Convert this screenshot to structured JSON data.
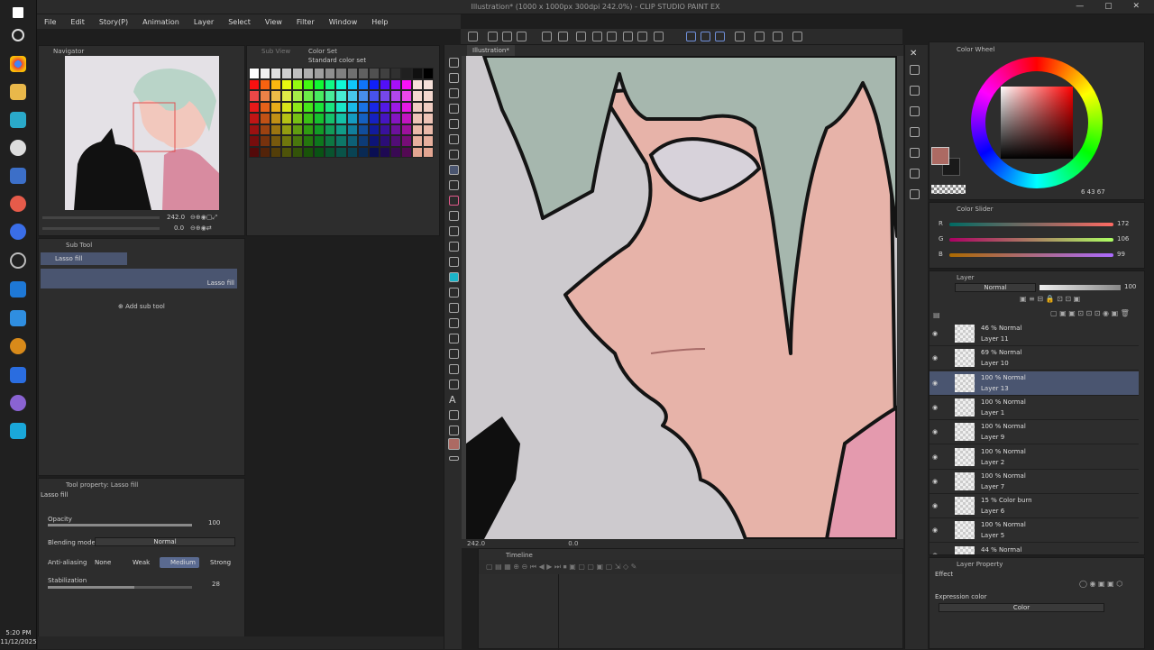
{
  "app": {
    "title": "Illustration* (1000 x 1000px 300dpi 242.0%) - CLIP STUDIO PAINT EX",
    "window_controls": "— ▢ ✕"
  },
  "menu": [
    "File",
    "Edit",
    "Story(P)",
    "Animation",
    "Layer",
    "Select",
    "View",
    "Filter",
    "Window",
    "Help"
  ],
  "taskbar": {
    "time": "5:20 PM",
    "date": "11/12/2025"
  },
  "navigator": {
    "tab": "Navigator",
    "zoom": "242.0",
    "angle": "0.0"
  },
  "colorset": {
    "tab_subview": "Sub View",
    "tab": "Color Set",
    "set_name": "Standard color set"
  },
  "subtool": {
    "tab": "Sub Tool",
    "header": "Lasso fill",
    "selected_label": "Lasso fill",
    "add_label": "Add sub tool"
  },
  "toolprop": {
    "tab": "Tool property: Lasso fill",
    "name": "Lasso fill",
    "opacity_label": "Opacity",
    "opacity_value": "100",
    "blend_label": "Blending mode",
    "blend_value": "Normal",
    "aa_label": "Anti-aliasing",
    "aa_options": [
      "None",
      "Weak",
      "Medium",
      "Strong"
    ],
    "stab_label": "Stabilization",
    "stab_value": "28",
    "opacity_level": 1.0,
    "stab_level": 0.6
  },
  "canvas": {
    "tab": "Illustration*",
    "zoom": "242.0",
    "angle": "0.0"
  },
  "timeline": {
    "tab": "Timeline"
  },
  "colorwheel": {
    "tab": "Color Wheel",
    "readout": "6  43  67",
    "main_color": "#ac6a63",
    "sub_color": "#1a1a1a"
  },
  "colorslider": {
    "tab": "Color Slider",
    "channels": [
      {
        "label": "R",
        "value": "172",
        "level": 0.674
      },
      {
        "label": "G",
        "value": "106",
        "level": 0.416
      },
      {
        "label": "B",
        "value": "99",
        "level": 0.388
      }
    ]
  },
  "layers": {
    "tab": "Layer",
    "blend": "Normal",
    "opacity": "100",
    "items": [
      {
        "mode": "46 % Normal",
        "name": "Layer 11",
        "selected": false
      },
      {
        "mode": "69 % Normal",
        "name": "Layer 10",
        "selected": false
      },
      {
        "mode": "100 % Normal",
        "name": "Layer 13",
        "selected": true
      },
      {
        "mode": "100 % Normal",
        "name": "Layer 1",
        "selected": false
      },
      {
        "mode": "100 % Normal",
        "name": "Layer 9",
        "selected": false
      },
      {
        "mode": "100 % Normal",
        "name": "Layer 2",
        "selected": false
      },
      {
        "mode": "100 % Normal",
        "name": "Layer 7",
        "selected": false
      },
      {
        "mode": "15 % Color burn",
        "name": "Layer 6",
        "selected": false
      },
      {
        "mode": "100 % Normal",
        "name": "Layer 5",
        "selected": false
      },
      {
        "mode": "44 % Normal",
        "name": "",
        "selected": false
      }
    ]
  },
  "layerprop": {
    "tab": "Layer Property",
    "effect_label": "Effect",
    "expr_label": "Expression color",
    "expr_value": "Color"
  }
}
